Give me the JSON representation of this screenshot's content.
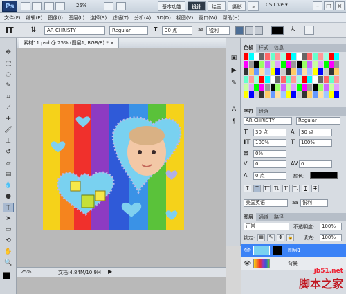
{
  "app": {
    "logo": "Ps",
    "zoom_label": "25%",
    "workspaces": [
      "基本功能",
      "设计",
      "绘画",
      "摄影"
    ],
    "active_workspace": "设计",
    "more": "»",
    "cs_live": "CS Live"
  },
  "menu": [
    "文件(F)",
    "编辑(E)",
    "图像(I)",
    "图层(L)",
    "选择(S)",
    "滤镜(T)",
    "分析(A)",
    "3D(D)",
    "视图(V)",
    "窗口(W)",
    "帮助(H)"
  ],
  "options": {
    "tool_icon": "text-tool",
    "font_family": "AR CHRISTY",
    "font_style": "Regular",
    "font_size": "30 点",
    "aa_icon": "aa",
    "aa_mode": "锐利"
  },
  "document": {
    "tab_title": "素材11.psd @ 25% (图层1, RGB/8) *",
    "close": "×"
  },
  "status": {
    "zoom": "25%",
    "doc_info": "文档:4.84M/10.9M"
  },
  "swatches_panel": {
    "tabs": [
      "色板",
      "样式",
      "信息"
    ],
    "active": "色板"
  },
  "char_panel": {
    "tabs": [
      "字符",
      "段落"
    ],
    "active": "字符",
    "font_family": "AR CHRISTY",
    "font_style": "Regular",
    "font_size": "30 点",
    "leading": "30 点",
    "vscale": "100%",
    "hscale": "100%",
    "tracking_pct": "0%",
    "kerning": "0",
    "tracking": "0",
    "baseline": "0 点",
    "color_label": "颜色:",
    "style_buttons": [
      "T",
      "T",
      "TT",
      "Tt",
      "T'",
      "T,",
      "T",
      "T"
    ],
    "language": "美国英语",
    "aa_icon": "aa",
    "aa_mode": "锐利"
  },
  "layers_panel": {
    "tabs": [
      "图层",
      "通道",
      "路径"
    ],
    "active": "图层",
    "blend_mode": "正常",
    "opacity_label": "不透明度:",
    "opacity": "100%",
    "lock_label": "锁定:",
    "fill_label": "填充:",
    "fill": "100%",
    "layers": [
      {
        "name": "图层1",
        "selected": true
      },
      {
        "name": "背景",
        "selected": false
      }
    ]
  },
  "watermark": {
    "site": "jb51.net",
    "name": "脚本之家"
  },
  "colors": {
    "accent": "#3b82f6",
    "foreground": "#000000",
    "background": "#ffffff",
    "text_color": "#000000"
  }
}
